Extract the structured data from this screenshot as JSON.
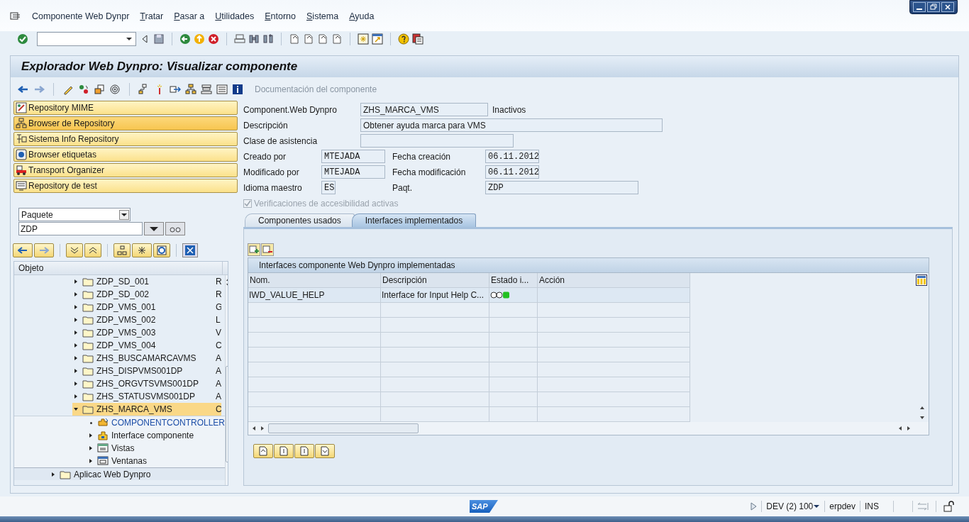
{
  "menu": [
    {
      "label": "Componente Web Dynpr",
      "mnemonic": false
    },
    {
      "label": "Tratar",
      "mnemonic": true
    },
    {
      "label": "Pasar a",
      "mnemonic": true
    },
    {
      "label": "Utilidades",
      "mnemonic": true
    },
    {
      "label": "Entorno",
      "mnemonic": true
    },
    {
      "label": "Sistema",
      "mnemonic": true
    },
    {
      "label": "Ayuda",
      "mnemonic": true
    }
  ],
  "title": "Explorador Web Dynpro: Visualizar componente",
  "app_toolbar": {
    "documentation": {
      "label": "Documentación del componente",
      "disabled": true
    }
  },
  "nav_buttons": [
    {
      "label": "Repository MIME",
      "kind": "mime",
      "selected": false
    },
    {
      "label": "Browser de Repository",
      "kind": "browser",
      "selected": true
    },
    {
      "label": "Sistema Info Repository",
      "kind": "info",
      "selected": false
    },
    {
      "label": "Browser etiquetas",
      "kind": "tags",
      "selected": false
    },
    {
      "label": "Transport Organizer",
      "kind": "transport",
      "selected": false
    },
    {
      "label": "Repository de test",
      "kind": "test",
      "selected": false
    }
  ],
  "object_selector": {
    "type": "Paquete",
    "value": "ZDP"
  },
  "tree": {
    "column": "Objeto",
    "items": [
      {
        "label": "ZDP_SD_001",
        "column_2": "R",
        "kind": "folder",
        "expanded": false,
        "selected": false
      },
      {
        "label": "ZDP_SD_002",
        "column_2": "R",
        "kind": "folder",
        "expanded": false,
        "selected": false
      },
      {
        "label": "ZDP_VMS_001",
        "column_2": "G",
        "kind": "folder",
        "expanded": false,
        "selected": false
      },
      {
        "label": "ZDP_VMS_002",
        "column_2": "L",
        "kind": "folder",
        "expanded": false,
        "selected": false
      },
      {
        "label": "ZDP_VMS_003",
        "column_2": "V",
        "kind": "folder",
        "expanded": false,
        "selected": false
      },
      {
        "label": "ZDP_VMS_004",
        "column_2": "C",
        "kind": "folder",
        "expanded": false,
        "selected": false
      },
      {
        "label": "ZHS_BUSCAMARCAVMS",
        "column_2": "A",
        "kind": "folder",
        "expanded": false,
        "selected": false
      },
      {
        "label": "ZHS_DISPVMS001DP",
        "column_2": "A",
        "kind": "folder",
        "expanded": false,
        "selected": false
      },
      {
        "label": "ZHS_ORGVTSVMS001DP",
        "column_2": "A",
        "kind": "folder",
        "expanded": false,
        "selected": false
      },
      {
        "label": "ZHS_STATUSVMS001DP",
        "column_2": "A",
        "kind": "folder",
        "expanded": false,
        "selected": false
      },
      {
        "label": "ZHS_MARCA_VMS",
        "column_2": "C",
        "kind": "folder",
        "expanded": true,
        "selected": true,
        "children": [
          {
            "label": "COMPONENTCONTROLLER",
            "kind": "controller",
            "link": true,
            "selected": false
          },
          {
            "label": "Interface componente",
            "kind": "interface",
            "expanded": false,
            "link": false,
            "selected": false
          },
          {
            "label": "Vistas",
            "kind": "views",
            "expanded": false,
            "link": false,
            "selected": false
          },
          {
            "label": "Ventanas",
            "kind": "windows",
            "expanded": false,
            "link": false,
            "selected": false
          }
        ]
      }
    ],
    "outer_item": {
      "label": "Aplicac Web Dynpro",
      "kind": "folder",
      "expanded": false
    }
  },
  "form": {
    "component": {
      "label": "Component.Web Dynpro",
      "value": "ZHS_MARCA_VMS",
      "status": "Inactivos"
    },
    "description": {
      "label": "Descripción",
      "value": "Obtener ayuda marca para VMS"
    },
    "help_class": {
      "label": "Clase de asistencia"
    },
    "created_by": {
      "label": "Creado por",
      "value": "MTEJADA"
    },
    "created_on": {
      "label": "Fecha creación",
      "value": "06.11.2012"
    },
    "modified_by": {
      "label": "Modificado por",
      "value": "MTEJADA"
    },
    "modified_on": {
      "label": "Fecha modificación",
      "value": "06.11.2012"
    },
    "language": {
      "label": "Idioma maestro",
      "value": "ES"
    },
    "package": {
      "label": "Paqt.",
      "value": "ZDP"
    },
    "accessibility": {
      "label": "Verificaciones de accesibilidad activas",
      "checked": true,
      "disabled": true
    }
  },
  "tabs": [
    {
      "label": "Componentes usados",
      "selected": false
    },
    {
      "label": "Interfaces implementados",
      "selected": true
    }
  ],
  "table": {
    "title": "Interfaces componente Web Dynpro implementadas",
    "columns": [
      "Nom.",
      "Descripción",
      "Estado i...",
      "Acción"
    ],
    "rows": [
      {
        "name": "IWD_VALUE_HELP",
        "description": "Interface for Input Help C...",
        "color": "#22c022"
      }
    ]
  },
  "status_bar": {
    "logo": "SAP",
    "system": "DEV (2) 100",
    "server": "erpdev",
    "mode": "INS"
  }
}
